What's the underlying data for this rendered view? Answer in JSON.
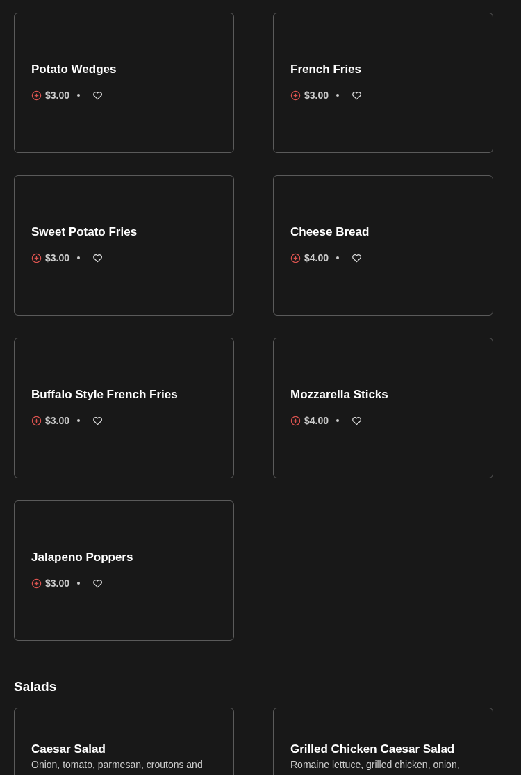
{
  "sections": [
    {
      "items": [
        {
          "name": "Potato Wedges",
          "price": "$3.00"
        },
        {
          "name": "French Fries",
          "price": "$3.00"
        },
        {
          "name": "Sweet Potato Fries",
          "price": "$3.00"
        },
        {
          "name": "Cheese Bread",
          "price": "$4.00"
        },
        {
          "name": "Buffalo Style French Fries",
          "price": "$3.00"
        },
        {
          "name": "Mozzarella Sticks",
          "price": "$4.00"
        },
        {
          "name": "Jalapeno Poppers",
          "price": "$3.00"
        }
      ]
    },
    {
      "title": "Salads",
      "items": [
        {
          "name": "Caesar Salad",
          "description": "Onion, tomato, parmesan, croutons and"
        },
        {
          "name": "Grilled Chicken Caesar Salad",
          "description": "Romaine lettuce, grilled chicken, onion,"
        }
      ]
    }
  ]
}
